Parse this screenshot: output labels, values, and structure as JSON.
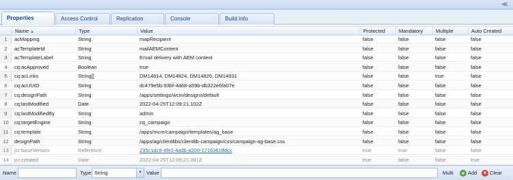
{
  "tabs": [
    {
      "label": "Properties",
      "active": true
    },
    {
      "label": "Access Control",
      "active": false
    },
    {
      "label": "Replication",
      "active": false
    },
    {
      "label": "Console",
      "active": false
    },
    {
      "label": "Build Info",
      "active": false
    }
  ],
  "columns": {
    "name": "Name",
    "type": "Type",
    "value": "Value",
    "protected": "Protected",
    "mandatory": "Mandatory",
    "multiple": "Multiple",
    "auto_created": "Auto Created"
  },
  "rows": [
    {
      "n": "1",
      "name": "acMapping",
      "type": "String",
      "value": "mapRecipient",
      "protected": "false",
      "mandatory": "false",
      "multiple": "false",
      "auto": "false"
    },
    {
      "n": "2",
      "name": "acTemplateId",
      "type": "String",
      "value": "mailAEMContent",
      "protected": "false",
      "mandatory": "false",
      "multiple": "false",
      "auto": "false"
    },
    {
      "n": "3",
      "name": "acTemplateLabel",
      "type": "String",
      "value": "Email delivery with AEM content",
      "protected": "false",
      "mandatory": "false",
      "multiple": "false",
      "auto": "false"
    },
    {
      "n": "4",
      "name": "cq:acApproved",
      "type": "Boolean",
      "value": "true",
      "protected": "false",
      "mandatory": "false",
      "multiple": "false",
      "auto": "false"
    },
    {
      "n": "5",
      "name": "cq:acLinks",
      "type": "String[]",
      "value": "DM14814, DM14824, DM14826, DM14831",
      "protected": "false",
      "mandatory": "false",
      "multiple": "true",
      "auto": "false"
    },
    {
      "n": "6",
      "name": "cq:acUUID",
      "type": "String",
      "value": "dc479e5b-93bf-4a68-a59b-db322e6fa07e",
      "protected": "false",
      "mandatory": "false",
      "multiple": "false",
      "auto": "false"
    },
    {
      "n": "7",
      "name": "cq:designPath",
      "type": "String",
      "value": "/apps/settings/wcm/designs/default",
      "protected": "false",
      "mandatory": "false",
      "multiple": "false",
      "auto": "false"
    },
    {
      "n": "8",
      "name": "cq:lastModified",
      "type": "Date",
      "value": "2022-04-25T12:09:21.102Z",
      "protected": "false",
      "mandatory": "false",
      "multiple": "false",
      "auto": "false"
    },
    {
      "n": "9",
      "name": "cq:lastModifiedBy",
      "type": "String",
      "value": "admin",
      "protected": "false",
      "mandatory": "false",
      "multiple": "false",
      "auto": "false"
    },
    {
      "n": "10",
      "name": "cq:targetEngine",
      "type": "String",
      "value": "cq_campaign",
      "protected": "false",
      "mandatory": "false",
      "multiple": "false",
      "auto": "false"
    },
    {
      "n": "11",
      "name": "cq:template",
      "type": "String",
      "value": "/apps/mcm/campaign/templates/ag_base",
      "protected": "false",
      "mandatory": "false",
      "multiple": "false",
      "auto": "false"
    },
    {
      "n": "12",
      "name": "designPath",
      "type": "String",
      "value": "/apps/ag/clientlibs/clientlib-campaign/css/campaign-ag-base.css",
      "protected": "false",
      "mandatory": "false",
      "multiple": "false",
      "auto": "false"
    },
    {
      "n": "13",
      "name": "jcr:baseVersion",
      "type": "Reference",
      "value": "235c1dc8-4fe2-4adb-a200-1716361ffdcc",
      "protected": "true",
      "mandatory": "true",
      "multiple": "false",
      "auto": "false",
      "dim": true,
      "link": true
    },
    {
      "n": "14",
      "name": "jcr:created",
      "type": "Date",
      "value": "2022-04-25T12:09:21.091Z",
      "protected": "true",
      "mandatory": "false",
      "multiple": "false",
      "auto": "true",
      "dim": true
    }
  ],
  "bottom": {
    "name_label": "Name",
    "name_value": "",
    "type_label": "Type",
    "type_value": "String",
    "value_label": "Value",
    "value_value": "",
    "multi_label": "Multi",
    "add_label": "Add",
    "clear_label": "Clear"
  },
  "icons": {
    "collapse": "double-chevron-down-icon",
    "sort": "sort-ascending-icon",
    "dropdown": "chevron-down-icon",
    "add": "plus-circle-icon",
    "clear": "x-circle-icon"
  },
  "colors": {
    "tab_text": "#15428b",
    "link": "#2a6bb5",
    "add": "#4ca844",
    "clear": "#d64a3a"
  }
}
